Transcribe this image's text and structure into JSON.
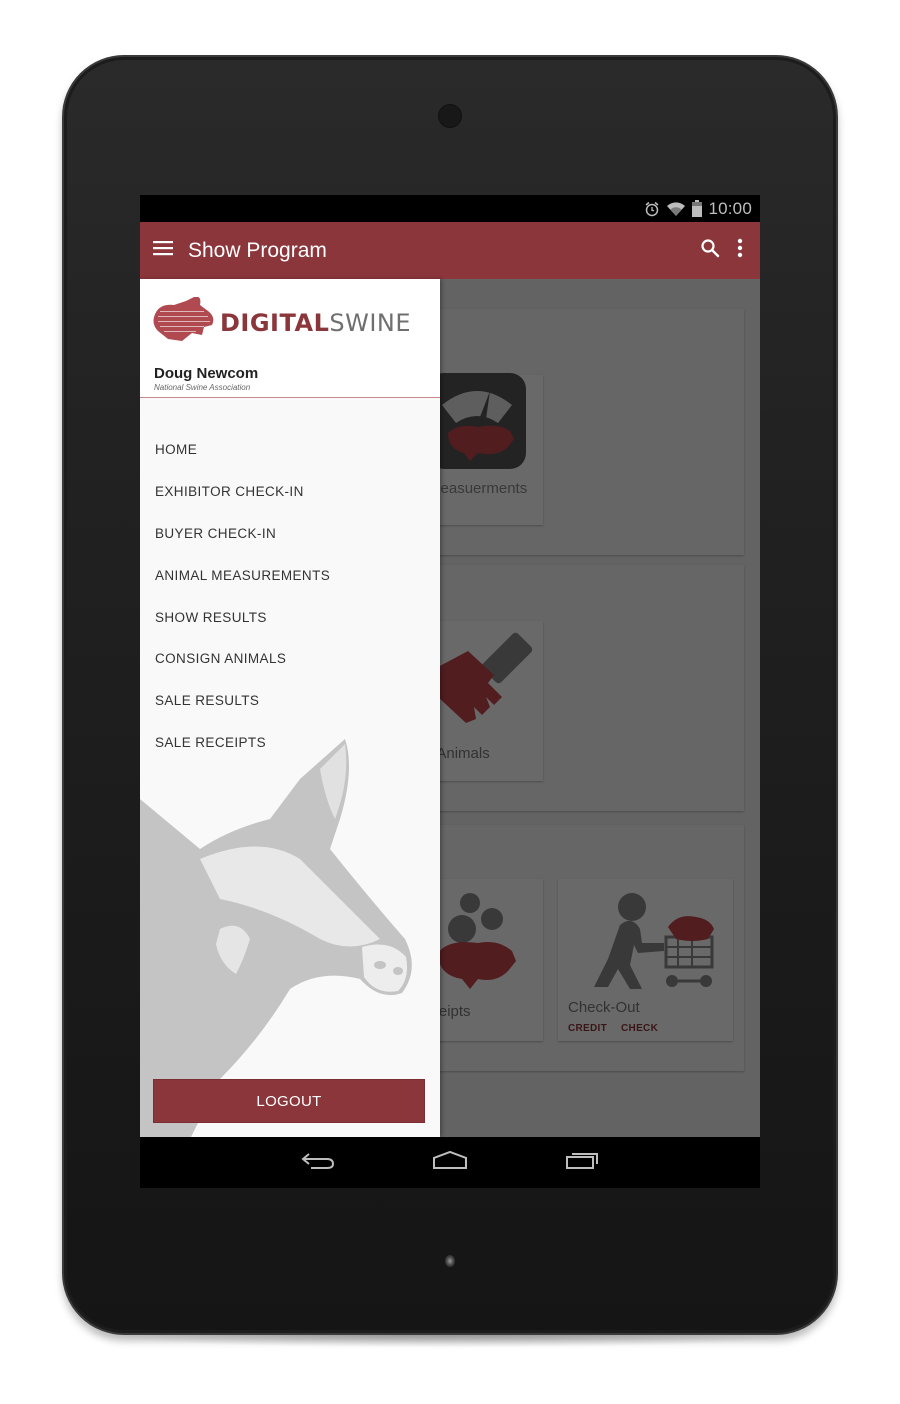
{
  "device": {
    "type": "android-tablet"
  },
  "status_bar": {
    "icons": [
      "alarm-icon",
      "wifi-icon",
      "battery-icon"
    ],
    "time": "10:00"
  },
  "app_bar": {
    "menu_icon": "hamburger-menu-icon",
    "title": "Show Program",
    "actions": [
      "search-icon",
      "overflow-menu-icon"
    ],
    "color": "#8b363b"
  },
  "drawer": {
    "logo": {
      "mark": "digital-pig-logo",
      "text_part1": "DIGITAL",
      "text_part2": "SWINE"
    },
    "user": {
      "name": "Doug Newcom",
      "organization": "National Swine Association"
    },
    "items": [
      {
        "label": "HOME"
      },
      {
        "label": "EXHIBITOR CHECK-IN"
      },
      {
        "label": "BUYER CHECK-IN"
      },
      {
        "label": "ANIMAL MEASUREMENTS"
      },
      {
        "label": "SHOW RESULTS"
      },
      {
        "label": "CONSIGN ANIMALS"
      },
      {
        "label": "SALE RESULTS"
      },
      {
        "label": "SALE RECEIPTS"
      }
    ],
    "logout_label": "LOGOUT"
  },
  "background_cards": [
    {
      "label": "Animal Measuerments",
      "visible_label": "easuerments",
      "icon": "scale-pig-icon"
    },
    {
      "label": "Consign Animals",
      "visible_label": "nimals",
      "icon": "handshake-icon"
    },
    {
      "label": "Sale Receipts",
      "visible_label": "ts",
      "icon": "piggy-bank-icon"
    },
    {
      "label": "Check-Out",
      "visible_label": "Check-Out",
      "icon": "cart-pig-icon",
      "actions": [
        "CREDIT",
        "CHECK"
      ]
    }
  ],
  "nav_bar": {
    "keys": [
      "back-icon",
      "home-icon",
      "recent-apps-icon"
    ]
  },
  "colors": {
    "brand": "#8b363b",
    "brand_gray": "#6f6f6f"
  }
}
